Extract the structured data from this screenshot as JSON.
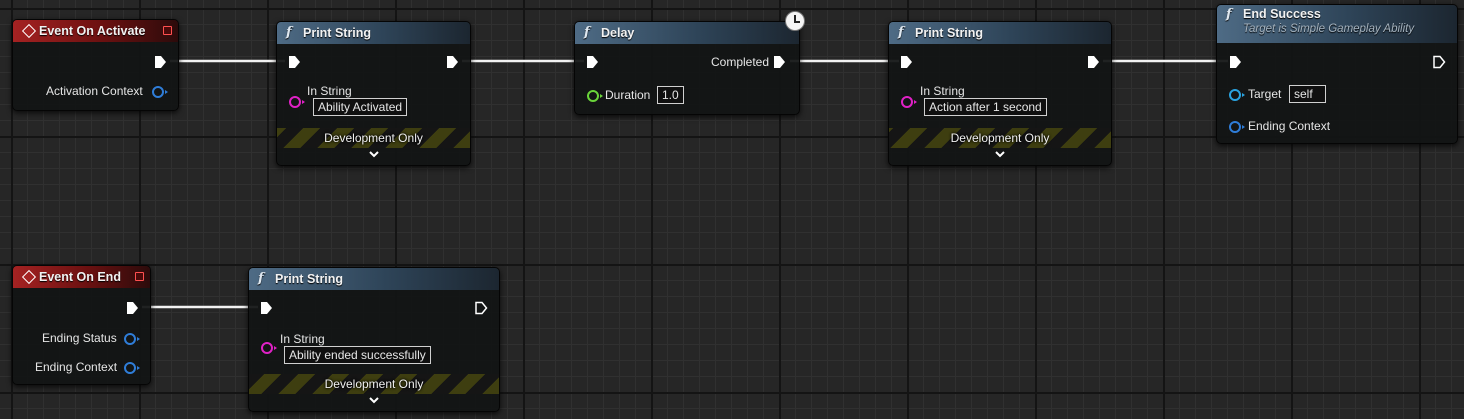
{
  "nodes": {
    "event_on_activate": {
      "title": "Event On Activate",
      "pins": {
        "activation_context": "Activation Context"
      }
    },
    "print_string_1": {
      "title": "Print String",
      "in_string_label": "In String",
      "in_string_value": "Ability Activated",
      "dev_label": "Development Only"
    },
    "delay": {
      "title": "Delay",
      "completed_label": "Completed",
      "duration_label": "Duration",
      "duration_value": "1.0"
    },
    "print_string_2": {
      "title": "Print String",
      "in_string_label": "In String",
      "in_string_value": "Action after 1 second",
      "dev_label": "Development Only"
    },
    "end_success": {
      "title": "End Success",
      "subtitle": "Target is Simple Gameplay Ability",
      "target_label": "Target",
      "target_value": "self",
      "ending_context_label": "Ending Context"
    },
    "event_on_end": {
      "title": "Event On End",
      "pins": {
        "ending_status": "Ending Status",
        "ending_context": "Ending Context"
      }
    },
    "print_string_3": {
      "title": "Print String",
      "in_string_label": "In String",
      "in_string_value": "Ability ended successfully",
      "dev_label": "Development Only"
    }
  },
  "colors": {
    "function_header": "#4e6b85",
    "event_header": "#a52222",
    "struct_pin": "#2f7dd8",
    "string_pin": "#e021c6",
    "float_pin": "#6ad43a",
    "object_pin": "#2aa3e0",
    "exec_wire": "#ffffff"
  },
  "icons": {
    "function": "function-icon",
    "event": "event-icon",
    "latent": "clock-icon",
    "delegate": "delegate-icon"
  }
}
